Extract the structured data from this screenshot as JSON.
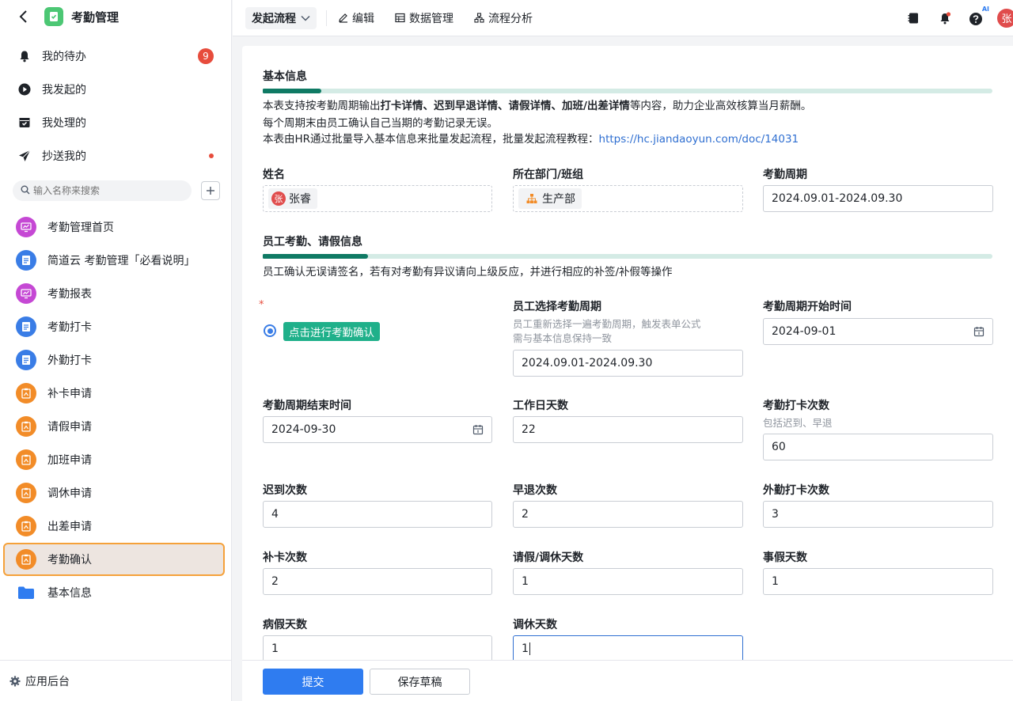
{
  "app": {
    "title": "考勤管理",
    "avatar_initial": "张"
  },
  "quick": {
    "todo_label": "我的待办",
    "todo_count": "9",
    "initiated_label": "我发起的",
    "handled_label": "我处理的",
    "cc_label": "抄送我的"
  },
  "search": {
    "placeholder": "输入名称来搜索"
  },
  "nav": {
    "items": [
      {
        "label": "考勤管理首页",
        "icon": "dashboard-icon",
        "color": "#c548d4"
      },
      {
        "label": "简道云 考勤管理「必看说明」",
        "icon": "document-icon",
        "color": "#3a7de6"
      },
      {
        "label": "考勤报表",
        "icon": "dashboard-icon",
        "color": "#c548d4"
      },
      {
        "label": "考勤打卡",
        "icon": "document-icon",
        "color": "#3a7de6"
      },
      {
        "label": "外勤打卡",
        "icon": "document-icon",
        "color": "#3a7de6"
      },
      {
        "label": "补卡申请",
        "icon": "workflow-icon",
        "color": "#f28c28"
      },
      {
        "label": "请假申请",
        "icon": "workflow-icon",
        "color": "#f28c28"
      },
      {
        "label": "加班申请",
        "icon": "workflow-icon",
        "color": "#f28c28"
      },
      {
        "label": "调休申请",
        "icon": "workflow-icon",
        "color": "#f28c28"
      },
      {
        "label": "出差申请",
        "icon": "workflow-icon",
        "color": "#f28c28"
      },
      {
        "label": "考勤确认",
        "icon": "workflow-icon",
        "color": "#f28c28"
      },
      {
        "label": "基本信息",
        "icon": "folder-icon",
        "color": "#2f7cf0"
      }
    ],
    "active_label": "考勤确认"
  },
  "sidebar_footer": {
    "label": "应用后台"
  },
  "topbar": {
    "launch_label": "发起流程",
    "edit_label": "编辑",
    "data_label": "数据管理",
    "analysis_label": "流程分析",
    "ai_badge": "AI"
  },
  "form": {
    "section1": {
      "title": "基本信息",
      "line1_prefix": "本表支持按考勤周期输出",
      "line1_bold": "打卡详情、迟到早退详情、请假详情、加班/出差详情",
      "line1_suffix": "等内容，助力企业高效核算当月薪酬。",
      "line2": "每个周期末由员工确认自己当期的考勤记录无误。",
      "line3_prefix": "本表由HR通过批量导入基本信息来批量发起流程，批量发起流程教程：",
      "line3_link": "https://hc.jiandaoyun.com/doc/14031"
    },
    "name": {
      "label": "姓名",
      "value": "张睿",
      "avatar": "张"
    },
    "dept": {
      "label": "所在部门/班组",
      "value": "生产部"
    },
    "period": {
      "label": "考勤周期",
      "value": "2024.09.01-2024.09.30"
    },
    "section2": {
      "title": "员工考勤、请假信息",
      "desc": "员工确认无误请签名，若有对考勤有异议请向上级反应，并进行相应的补签/补假等操作"
    },
    "confirm": {
      "required": "*",
      "label": "点击进行考勤确认"
    },
    "select_period": {
      "label": "员工选择考勤周期",
      "hint1": "员工重新选择一遍考勤周期，触发表单公式",
      "hint2": "需与基本信息保持一致",
      "value": "2024.09.01-2024.09.30"
    },
    "start_date": {
      "label": "考勤周期开始时间",
      "value": "2024-09-01"
    },
    "end_date": {
      "label": "考勤周期结束时间",
      "value": "2024-09-30"
    },
    "workdays": {
      "label": "工作日天数",
      "value": "22"
    },
    "punch_count": {
      "label": "考勤打卡次数",
      "hint": "包括迟到、早退",
      "value": "60"
    },
    "late_count": {
      "label": "迟到次数",
      "value": "4"
    },
    "early_count": {
      "label": "早退次数",
      "value": "2"
    },
    "field_punch": {
      "label": "外勤打卡次数",
      "value": "3"
    },
    "makeup_count": {
      "label": "补卡次数",
      "value": "2"
    },
    "leave_days": {
      "label": "请假/调休天数",
      "value": "1"
    },
    "personal_leave": {
      "label": "事假天数",
      "value": "1"
    },
    "sick_leave": {
      "label": "病假天数",
      "value": "1"
    },
    "comp_leave": {
      "label": "调休天数",
      "value": "1"
    }
  },
  "actions": {
    "submit_label": "提交",
    "draft_label": "保存草稿"
  }
}
